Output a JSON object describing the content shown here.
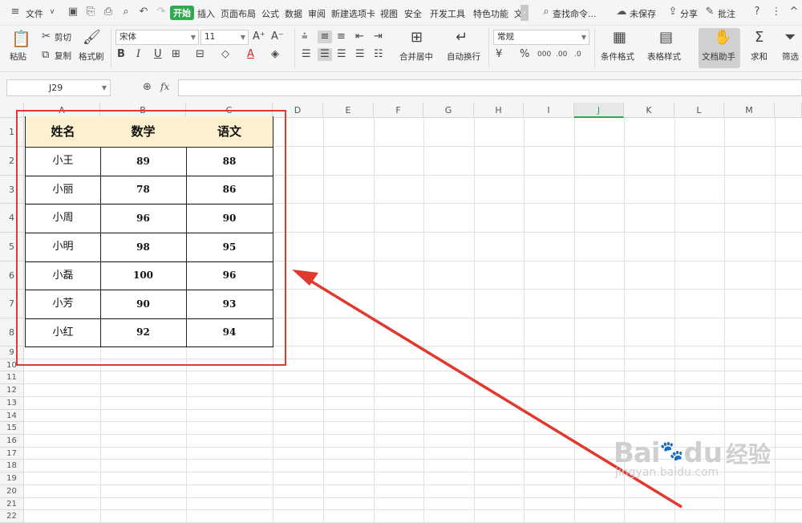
{
  "menubar": {
    "items": [
      "文件",
      "开始",
      "插入",
      "页面布局",
      "公式",
      "数据",
      "审阅",
      "新建选项卡",
      "视图",
      "安全",
      "开发工具",
      "特色功能",
      "文"
    ],
    "active": "开始",
    "search_label": "查找命令...",
    "unsaved_label": "未保存",
    "share_label": "分享",
    "comment_label": "批注"
  },
  "ribbon": {
    "paste": "粘贴",
    "cut": "剪切",
    "copy": "复制",
    "format_painter": "格式刷",
    "font_name": "宋体",
    "font_size": "11",
    "merge_center": "合并居中",
    "wrap_text": "自动换行",
    "number_format": "常规",
    "conditional_format": "条件格式",
    "table_style": "表格样式",
    "doc_assistant": "文档助手",
    "sum": "求和",
    "filter": "筛选"
  },
  "formula_bar": {
    "cell_ref": "J29",
    "fx": "fx",
    "value": ""
  },
  "grid": {
    "columns": [
      "A",
      "B",
      "C",
      "D",
      "E",
      "F",
      "G",
      "H",
      "I",
      "J",
      "K",
      "L",
      "M"
    ],
    "selected_column": "J",
    "rows": [
      "1",
      "2",
      "3",
      "4",
      "5",
      "6",
      "7",
      "8",
      "9",
      "10",
      "11",
      "12",
      "13",
      "14",
      "15",
      "16",
      "17",
      "18",
      "19",
      "20",
      "21",
      "22"
    ]
  },
  "table": {
    "headers": [
      "姓名",
      "数学",
      "语文"
    ],
    "rows": [
      [
        "小王",
        "89",
        "88"
      ],
      [
        "小丽",
        "78",
        "86"
      ],
      [
        "小周",
        "96",
        "90"
      ],
      [
        "小明",
        "98",
        "95"
      ],
      [
        "小磊",
        "100",
        "96"
      ],
      [
        "小芳",
        "90",
        "93"
      ],
      [
        "小红",
        "92",
        "94"
      ]
    ]
  },
  "watermark": {
    "brand": "Bai",
    "brand2": "du",
    "cn": "经验",
    "url": "jingyan.baidu.com"
  },
  "colors": {
    "accent": "#2fa84f",
    "annotation": "#e03a2e",
    "header_fill": "#fdf0cf"
  }
}
